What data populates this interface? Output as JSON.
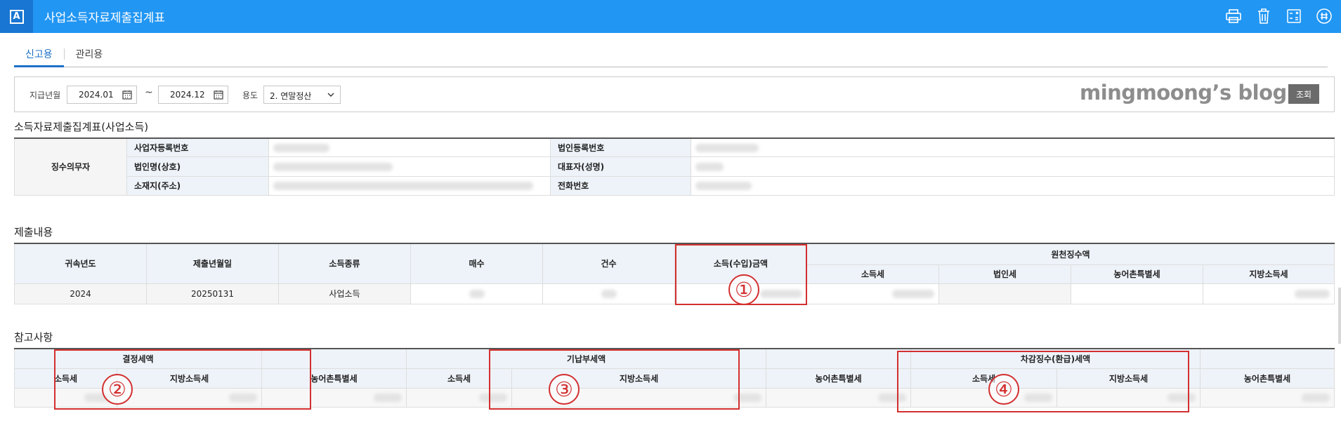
{
  "app": {
    "logo_letter": "A",
    "title": "사업소득자료제출집계표"
  },
  "toolbar_icons": [
    "print-icon",
    "trash-icon",
    "calculator-icon",
    "grid-icon"
  ],
  "tabs": [
    {
      "label": "신고용",
      "active": true
    },
    {
      "label": "관리용",
      "active": false
    }
  ],
  "filter": {
    "period_label": "지급년월",
    "start": "2024.01",
    "tilde": "~",
    "end": "2024.12",
    "usage_label": "용도",
    "usage_value": "2. 연말정산",
    "watermark": "mingmoong’s blog",
    "query_label": "조회"
  },
  "section1": {
    "title": "소득자료제출집계표(사업소득)",
    "payer_label": "징수의무자",
    "rows": [
      {
        "label": "사업자등록번호",
        "label2": "법인등록번호"
      },
      {
        "label": "법인명(상호)",
        "label2": "대표자(성명)"
      },
      {
        "label": "소재지(주소)",
        "label2": "전화번호"
      }
    ]
  },
  "section2": {
    "title": "제출내용",
    "headers": {
      "year": "귀속년도",
      "date": "제출년월일",
      "type": "소득종류",
      "sheets": "매수",
      "count": "건수",
      "amount": "소득(수입)금액",
      "withholding": "원천징수액",
      "income_tax": "소득세",
      "corp_tax": "법인세",
      "rural_tax": "농어촌특별세",
      "local_tax": "지방소득세"
    },
    "row": {
      "year": "2024",
      "date": "20250131",
      "type": "사업소득"
    }
  },
  "section3": {
    "title": "참고사항",
    "groups": {
      "decided": "결정세액",
      "paid": "기납부세액",
      "diff": "차감징수(환급)세액"
    },
    "cols": {
      "income_tax": "소득세",
      "local_tax": "지방소득세",
      "rural_tax": "농어촌특별세"
    }
  },
  "annotations": [
    "①",
    "②",
    "③",
    "④"
  ],
  "colors": {
    "appbar": "#2196f3",
    "accent_tab": "#1e6fc7",
    "highlight": "#d32f2f",
    "header_bg": "#eef3f9"
  }
}
